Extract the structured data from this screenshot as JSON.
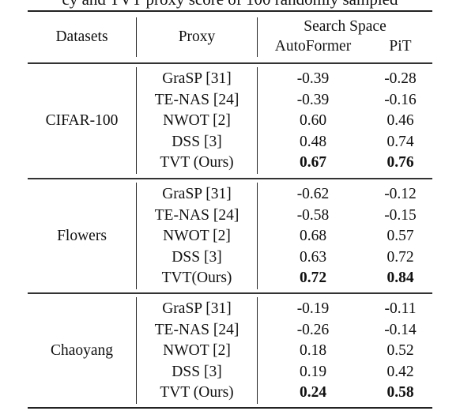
{
  "caption_fragment": "cy and TVT proxy score of 100 randomly sampled",
  "table": {
    "headers": {
      "datasets": "Datasets",
      "proxy": "Proxy",
      "search_space": "Search Space",
      "autoformer": "AutoFormer",
      "pit": "PiT"
    },
    "groups": [
      {
        "dataset": "CIFAR-100",
        "rows": [
          {
            "proxy": "GraSP [31]",
            "autoformer": "-0.39",
            "pit": "-0.28",
            "best": false
          },
          {
            "proxy": "TE-NAS [24]",
            "autoformer": "-0.39",
            "pit": "-0.16",
            "best": false
          },
          {
            "proxy": "NWOT [2]",
            "autoformer": "0.60",
            "pit": "0.46",
            "best": false
          },
          {
            "proxy": "DSS [3]",
            "autoformer": "0.48",
            "pit": "0.74",
            "best": false
          },
          {
            "proxy": "TVT (Ours)",
            "autoformer": "0.67",
            "pit": "0.76",
            "best": true
          }
        ]
      },
      {
        "dataset": "Flowers",
        "rows": [
          {
            "proxy": "GraSP [31]",
            "autoformer": "-0.62",
            "pit": "-0.12",
            "best": false
          },
          {
            "proxy": "TE-NAS [24]",
            "autoformer": "-0.58",
            "pit": "-0.15",
            "best": false
          },
          {
            "proxy": "NWOT [2]",
            "autoformer": "0.68",
            "pit": "0.57",
            "best": false
          },
          {
            "proxy": "DSS [3]",
            "autoformer": "0.63",
            "pit": "0.72",
            "best": false
          },
          {
            "proxy": "TVT(Ours)",
            "autoformer": "0.72",
            "pit": "0.84",
            "best": true
          }
        ]
      },
      {
        "dataset": "Chaoyang",
        "rows": [
          {
            "proxy": "GraSP [31]",
            "autoformer": "-0.19",
            "pit": "-0.11",
            "best": false
          },
          {
            "proxy": "TE-NAS [24]",
            "autoformer": "-0.26",
            "pit": "-0.14",
            "best": false
          },
          {
            "proxy": "NWOT [2]",
            "autoformer": "0.18",
            "pit": "0.52",
            "best": false
          },
          {
            "proxy": "DSS [3]",
            "autoformer": "0.19",
            "pit": "0.42",
            "best": false
          },
          {
            "proxy": "TVT (Ours)",
            "autoformer": "0.24",
            "pit": "0.58",
            "best": true
          }
        ]
      }
    ]
  }
}
